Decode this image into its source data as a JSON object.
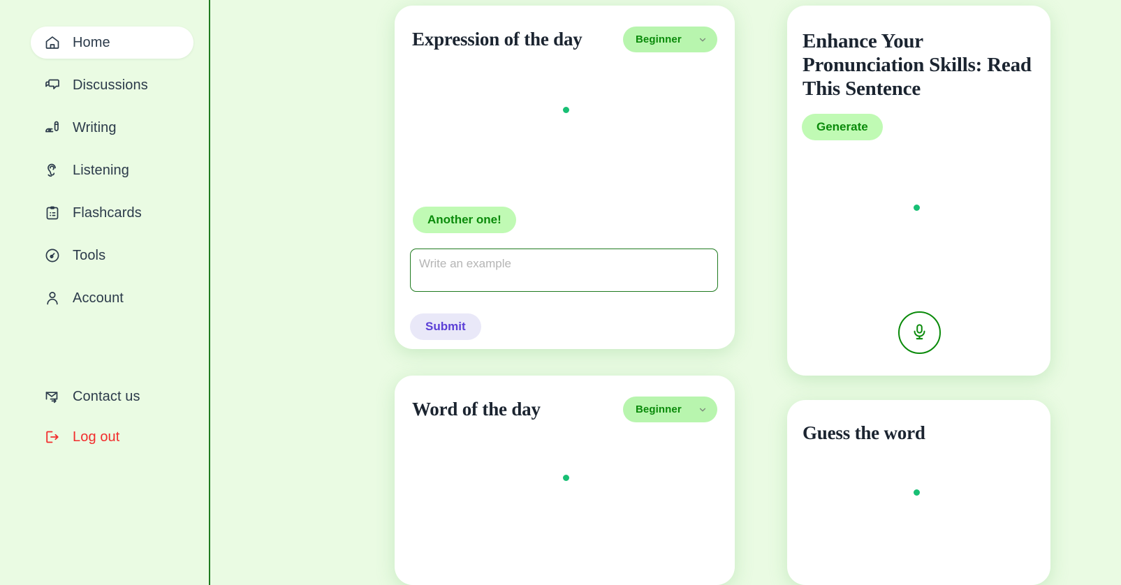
{
  "app": {
    "background_color": "#eafbe3",
    "accent_green": "#0a8a0a",
    "loader_color": "#18bf74"
  },
  "sidebar": {
    "items": [
      {
        "label": "Home",
        "icon": "home-icon",
        "active": true
      },
      {
        "label": "Discussions",
        "icon": "chat-bubbles-icon",
        "active": false
      },
      {
        "label": "Writing",
        "icon": "pen-icon",
        "active": false
      },
      {
        "label": "Listening",
        "icon": "ear-icon",
        "active": false
      },
      {
        "label": "Flashcards",
        "icon": "clipboard-icon",
        "active": false
      },
      {
        "label": "Tools",
        "icon": "gauge-icon",
        "active": false
      },
      {
        "label": "Account",
        "icon": "user-icon",
        "active": false
      }
    ],
    "bottom_items": [
      {
        "label": "Contact us",
        "icon": "mail-forward-icon",
        "danger": false
      },
      {
        "label": "Log out",
        "icon": "logout-icon",
        "danger": true,
        "color": "#f22c2c"
      }
    ]
  },
  "cards": {
    "expression": {
      "title": "Expression of the day",
      "level": "Beginner",
      "level_chevron": "chevron-down-icon",
      "another_label": "Another one!",
      "input_placeholder": "Write an example",
      "input_value": "",
      "submit_label": "Submit",
      "loading": true
    },
    "word": {
      "title": "Word of the day",
      "level": "Beginner",
      "level_chevron": "chevron-down-icon",
      "loading": true
    },
    "pronunciation": {
      "title": "Enhance Your Pronunciation Skills: Read This Sentence",
      "generate_label": "Generate",
      "mic_icon": "microphone-icon",
      "loading": true
    },
    "guess": {
      "title": "Guess the word",
      "loading": true
    }
  }
}
